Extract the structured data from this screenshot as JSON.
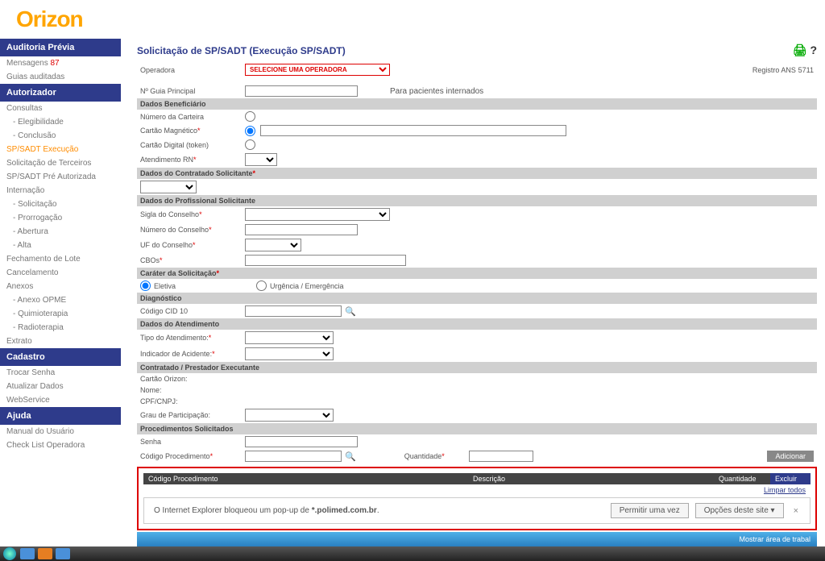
{
  "brand": "Orizon",
  "sidebar": {
    "sections": [
      {
        "title": "Auditoria Prévia",
        "items": [
          {
            "label": "Mensagens",
            "badge": "87"
          },
          {
            "label": "Guias auditadas"
          }
        ]
      },
      {
        "title": "Autorizador",
        "items": [
          {
            "label": "Consultas"
          },
          {
            "label": "- Elegibilidade",
            "sub": true
          },
          {
            "label": "- Conclusão",
            "sub": true
          },
          {
            "label": "SP/SADT Execução",
            "active": true
          },
          {
            "label": "Solicitação de Terceiros"
          },
          {
            "label": "SP/SADT Pré Autorizada"
          },
          {
            "label": "Internação"
          },
          {
            "label": "- Solicitação",
            "sub": true
          },
          {
            "label": "- Prorrogação",
            "sub": true
          },
          {
            "label": "- Abertura",
            "sub": true
          },
          {
            "label": "- Alta",
            "sub": true
          },
          {
            "label": "Fechamento de Lote"
          },
          {
            "label": "Cancelamento"
          },
          {
            "label": "Anexos"
          },
          {
            "label": "- Anexo OPME",
            "sub": true
          },
          {
            "label": "- Quimioterapia",
            "sub": true
          },
          {
            "label": "- Radioterapia",
            "sub": true
          },
          {
            "label": "Extrato"
          }
        ]
      },
      {
        "title": "Cadastro",
        "items": [
          {
            "label": "Trocar Senha"
          },
          {
            "label": "Atualizar Dados"
          },
          {
            "label": "WebService"
          }
        ]
      },
      {
        "title": "Ajuda",
        "items": [
          {
            "label": "Manual do Usuário"
          },
          {
            "label": "Check List Operadora"
          }
        ]
      }
    ]
  },
  "page": {
    "title": "Solicitação de SP/SADT (Execução SP/SADT)",
    "operadora_label": "Operadora",
    "operadora_option": "SELECIONE UMA OPERADORA",
    "registro_label": "Registro ANS",
    "registro_value": "5711",
    "guia_label": "Nº Guia Principal",
    "guia_hint": "Para pacientes internados",
    "sec_beneficiario": "Dados Beneficiário",
    "numero_carteira": "Número da Carteira",
    "cartao_magnetico": "Cartão Magnético",
    "cartao_digital": "Cartão Digital (token)",
    "atendimento_rn": "Atendimento RN",
    "sec_contratado": "Dados do Contratado Solicitante",
    "sec_profissional": "Dados do Profissional Solicitante",
    "sigla_conselho": "Sigla do Conselho",
    "numero_conselho": "Número do Conselho",
    "uf_conselho": "UF do Conselho",
    "cbos": "CBOs",
    "sec_carater": "Caráter da Solicitação",
    "eletiva": "Eletiva",
    "urgencia": "Urgência / Emergência",
    "sec_diagnostico": "Diagnóstico",
    "codigo_cid": "Código CID 10",
    "sec_atendimento": "Dados do Atendimento",
    "tipo_atendimento": "Tipo do Atendimento:",
    "indicador_acidente": "Indicador de Acidente:",
    "sec_executante": "Contratado / Prestador Executante",
    "cartao_orizon": "Cartão Orizon:",
    "nome": "Nome:",
    "cpf_cnpj": "CPF/CNPJ:",
    "grau_part": "Grau de Participação:",
    "sec_procedimentos": "Procedimentos Solicitados",
    "senha": "Senha",
    "codigo_proc": "Código Procedimento",
    "quantidade": "Quantidade",
    "adicionar": "Adicionar",
    "th_codigo": "Código Procedimento",
    "th_descricao": "Descrição",
    "th_qtd": "Quantidade",
    "th_excluir": "Excluir",
    "limpar": "Limpar todos"
  },
  "popup": {
    "text_pre": "O Internet Explorer bloqueou um pop-up de ",
    "domain": "*.polimed.com.br",
    "permitir": "Permitir uma vez",
    "opcoes": "Opções deste site ▾"
  },
  "footer": {
    "status": "Mostrar área de trabal"
  }
}
